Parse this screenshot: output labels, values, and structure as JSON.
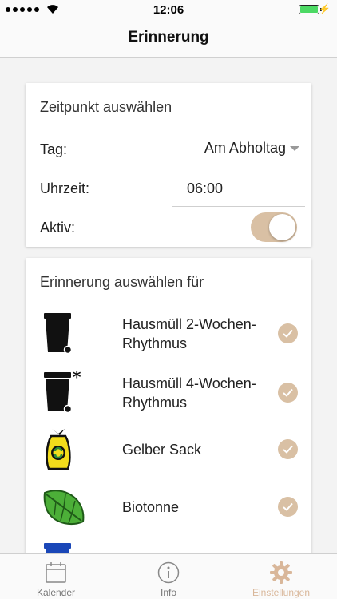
{
  "status_bar": {
    "time": "12:06"
  },
  "nav": {
    "title": "Erinnerung"
  },
  "time_card": {
    "heading": "Zeitpunkt auswählen",
    "day_label": "Tag:",
    "day_value": "Am Abholtag",
    "time_label": "Uhrzeit:",
    "time_value": "06:00",
    "active_label": "Aktiv:",
    "active_on": true
  },
  "reminder_card": {
    "heading": "Erinnerung auswählen für",
    "items": [
      {
        "label": "Hausmüll 2-Wochen-Rhythmus",
        "icon": "black-bin-icon",
        "checked": true
      },
      {
        "label": "Hausmüll 4-Wochen-Rhythmus",
        "icon": "black-bin-star-icon",
        "checked": true
      },
      {
        "label": "Gelber Sack",
        "icon": "yellow-bag-icon",
        "checked": true
      },
      {
        "label": "Biotonne",
        "icon": "green-leaf-icon",
        "checked": true
      }
    ]
  },
  "tabs": [
    {
      "label": "Kalender",
      "icon": "calendar-icon",
      "active": false
    },
    {
      "label": "Info",
      "icon": "info-icon",
      "active": false
    },
    {
      "label": "Einstellungen",
      "icon": "gear-icon",
      "active": true
    }
  ],
  "colors": {
    "accent": "#d9c0a4",
    "tab_active": "#d9b79a",
    "background": "#f3f3f3"
  }
}
